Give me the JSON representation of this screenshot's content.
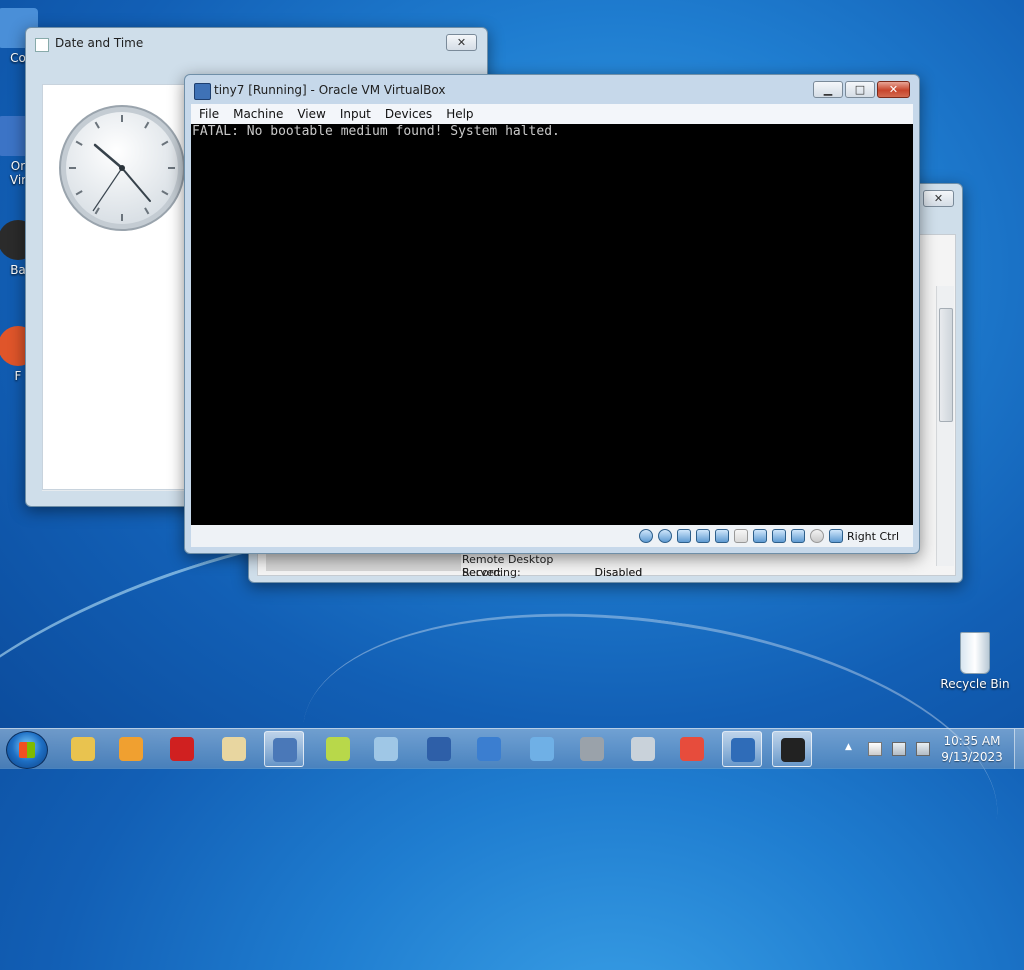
{
  "desktop": {
    "icons": [
      {
        "label": "Co",
        "color": "#4a8fd8"
      },
      {
        "label": "Or\nVir",
        "color": "#3c74c6"
      },
      {
        "label": "Ba",
        "color": "#2b2b2b"
      },
      {
        "label": "F",
        "color": "#e0552a"
      }
    ],
    "recycle_bin": {
      "label": "Recycle Bin",
      "icon": "recycle-bin-icon"
    }
  },
  "datetime_window": {
    "title": "Date and Time",
    "close_label": "✕"
  },
  "bg_window": {
    "close_label": "✕",
    "rows": [
      {
        "key": "Remote Desktop Server:",
        "value": "Disabled"
      },
      {
        "key": "Recording:",
        "value": "Disabled"
      }
    ]
  },
  "vbox": {
    "title": "tiny7 [Running] - Oracle VM VirtualBox",
    "minimize_label": "▁",
    "maximize_label": "□",
    "close_label": "✕",
    "menu": [
      "File",
      "Machine",
      "View",
      "Input",
      "Devices",
      "Help"
    ],
    "console_text": "FATAL: No bootable medium found! System halted.",
    "host_key": "Right Ctrl",
    "status_icons": [
      "hard-disk-icon",
      "optical-drive-icon",
      "audio-icon",
      "network-icon",
      "usb-icon",
      "shared-folder-icon",
      "display-icon",
      "video-capture-icon",
      "vt-x-icon",
      "mouse-integration-icon",
      "keyboard-icon"
    ]
  },
  "taskbar": {
    "items": [
      {
        "name": "file-explorer-icon",
        "color": "#e9c34f"
      },
      {
        "name": "media-player-icon",
        "color": "#f0a030"
      },
      {
        "name": "record-icon",
        "color": "#d02020"
      },
      {
        "name": "paint-icon",
        "color": "#e8d6a0"
      },
      {
        "name": "virtualbox-icon",
        "color": "#4a78b8",
        "active": true
      },
      {
        "name": "sticky-notes-icon",
        "color": "#b8d84a"
      },
      {
        "name": "notepad-icon",
        "color": "#9fc7e6"
      },
      {
        "name": "remote-desktop-icon",
        "color": "#2e5fa8"
      },
      {
        "name": "display-settings-icon",
        "color": "#3b7ed0"
      },
      {
        "name": "send-icon",
        "color": "#6fb0e6"
      },
      {
        "name": "fax-scan-icon",
        "color": "#9aa2aa"
      },
      {
        "name": "calculator-icon",
        "color": "#c9d2da"
      },
      {
        "name": "chrome-icon",
        "color": "#e74c3c"
      },
      {
        "name": "tiny7-icon",
        "color": "#2f6cb8",
        "active": true
      },
      {
        "name": "recorder-app-icon",
        "color": "#222222",
        "active": true
      }
    ],
    "clock_time": "10:35 AM",
    "clock_date": "9/13/2023"
  }
}
